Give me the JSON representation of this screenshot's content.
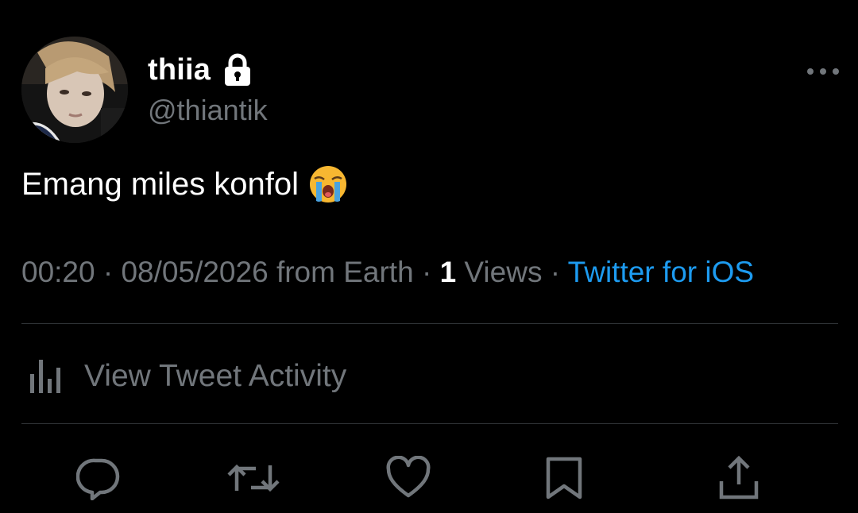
{
  "author": {
    "display_name": "thiia",
    "handle": "@thiantik",
    "protected_icon": "lock-icon",
    "avatar_icon": "profile-photo"
  },
  "tweet": {
    "text": "Emang miles konfol",
    "emoji": "loudly-crying-face-icon"
  },
  "meta": {
    "time": "00:20",
    "separator1": " · ",
    "date": "08/05/2026",
    "location": " from Earth",
    "separator2": " · ",
    "views_count": "1",
    "views_label": " Views",
    "separator3": " · ",
    "source": "Twitter for iOS"
  },
  "activity": {
    "label": "View Tweet Activity",
    "icon": "analytics-icon"
  },
  "actions": [
    {
      "name": "reply",
      "icon": "reply-icon"
    },
    {
      "name": "retweet",
      "icon": "retweet-icon"
    },
    {
      "name": "like",
      "icon": "heart-icon"
    },
    {
      "name": "bookmark",
      "icon": "bookmark-icon"
    },
    {
      "name": "share",
      "icon": "share-icon"
    }
  ],
  "colors": {
    "background": "#000000",
    "text_primary": "#ffffff",
    "text_secondary": "#71767b",
    "link": "#1d9bf0",
    "divider": "#2f3336"
  }
}
